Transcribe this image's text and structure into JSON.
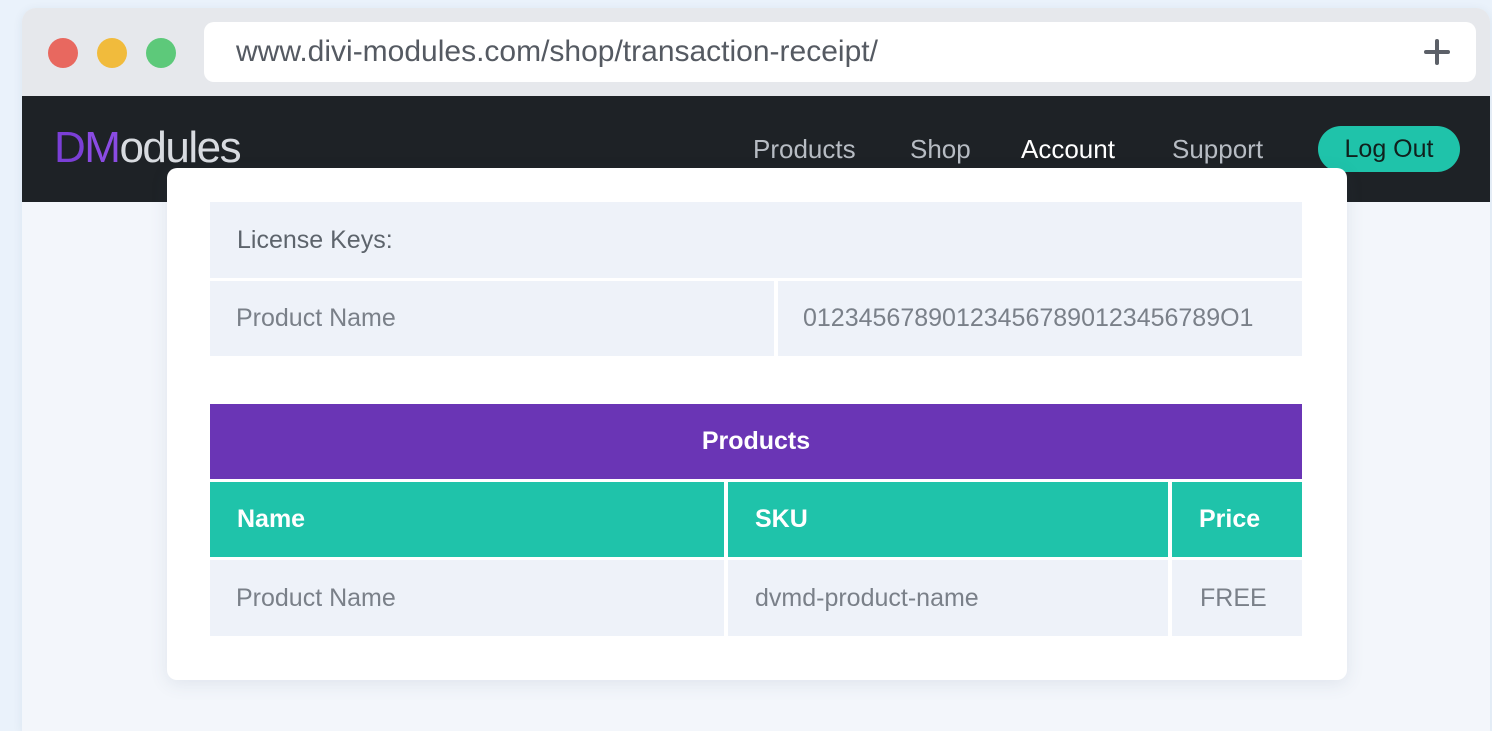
{
  "browser": {
    "url": "www.divi-modules.com/shop/transaction-receipt/",
    "new_tab_icon": "plus-icon"
  },
  "brand": {
    "logo_part1": "D",
    "logo_part2": "M",
    "logo_part3": "odules",
    "accent_color": "#7b3fd6",
    "teal_color": "#1fc3aa"
  },
  "nav": {
    "items": [
      {
        "label": "Products"
      },
      {
        "label": "Shop"
      },
      {
        "label": "Account"
      },
      {
        "label": "Support"
      }
    ],
    "active": "Account",
    "logout_label": "Log Out"
  },
  "license_keys": {
    "title": "License Keys:",
    "rows": [
      {
        "product": "Product Name",
        "key": "012345678901234567890123456789O1"
      }
    ]
  },
  "products_table": {
    "title": "Products",
    "header_color": "#6a35b5",
    "columns": [
      "Name",
      "SKU",
      "Price"
    ],
    "rows": [
      {
        "name": "Product Name",
        "sku": "dvmd-product-name",
        "price": "FREE"
      }
    ]
  }
}
